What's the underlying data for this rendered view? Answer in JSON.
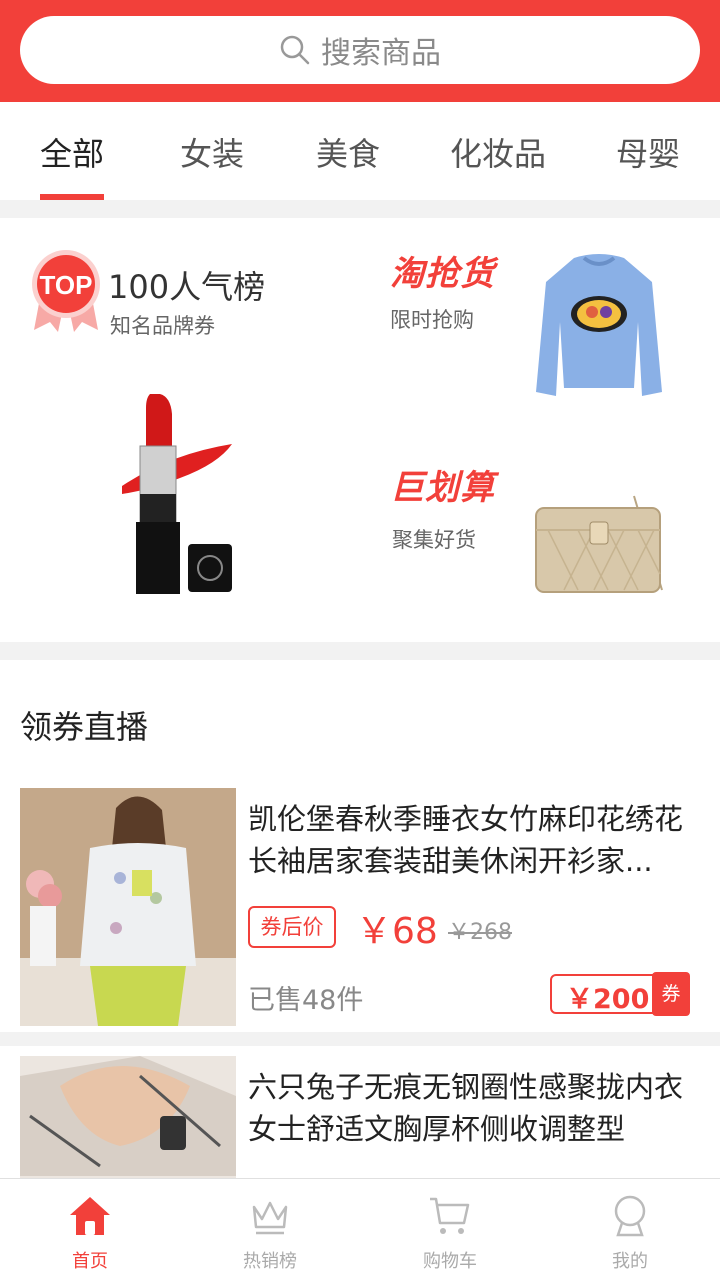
{
  "search": {
    "placeholder": "搜索商品"
  },
  "tabs": [
    {
      "label": "全部"
    },
    {
      "label": "女装"
    },
    {
      "label": "美食"
    },
    {
      "label": "化妆品"
    },
    {
      "label": "母婴"
    }
  ],
  "promo": {
    "top_badge": "TOP",
    "top_title": "100人气榜",
    "top_sub": "知名品牌券",
    "block1_title": "淘抢货",
    "block1_sub": "限时抢购",
    "block2_title": "巨划算",
    "block2_sub": "聚集好货"
  },
  "section": {
    "title": "领券直播",
    "items": [
      {
        "title": "凯伦堡春秋季睡衣女竹麻印花绣花长袖居家套装甜美休闲开衫家...",
        "coupon_label": "券后价",
        "price": "￥68",
        "orig_price": "￥268",
        "sold": "已售48件",
        "coupon_amount": "￥200",
        "coupon_word": "券"
      },
      {
        "title": "六只兔子无痕无钢圈性感聚拢内衣女士舒适文胸厚杯侧收调整型"
      }
    ]
  },
  "bottom_nav": [
    {
      "label": "首页"
    },
    {
      "label": "热销榜"
    },
    {
      "label": "购物车"
    },
    {
      "label": "我的"
    }
  ],
  "colors": {
    "brand": "#f2403a",
    "inactive": "#aaaaaa"
  }
}
